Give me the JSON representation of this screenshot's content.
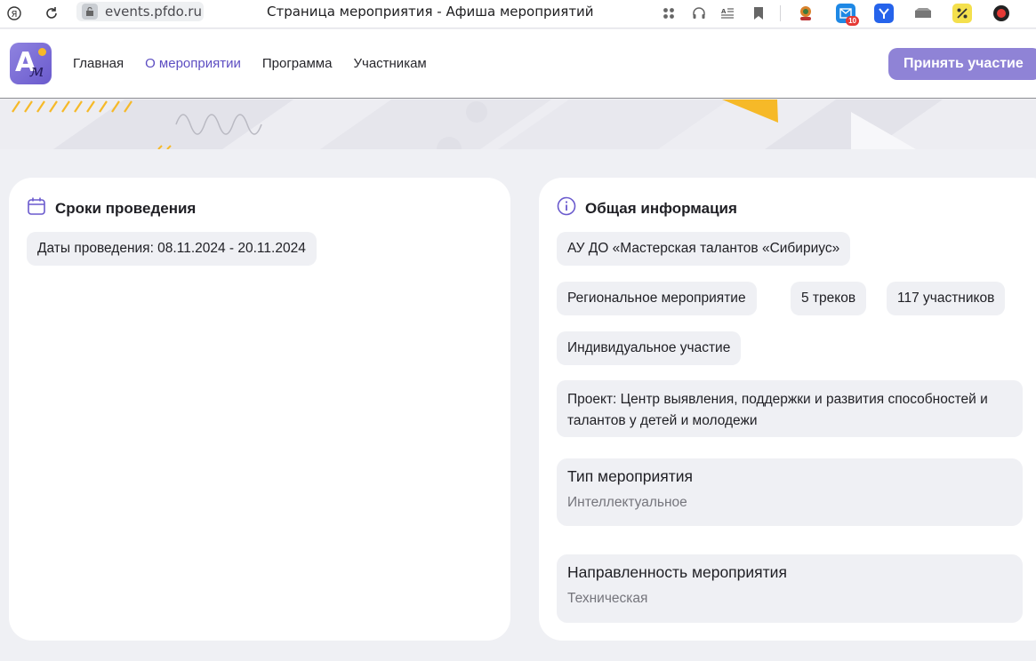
{
  "browser": {
    "url": "events.pfdo.ru",
    "tab_title": "Страница мероприятия - Афиша мероприятий",
    "mail_badge": "10"
  },
  "header": {
    "nav": [
      {
        "label": "Главная"
      },
      {
        "label": "О мероприятии",
        "active": true
      },
      {
        "label": "Программа"
      },
      {
        "label": "Участникам"
      }
    ],
    "cta_label": "Принять участие"
  },
  "schedule": {
    "title": "Сроки проведения",
    "dates": "Даты проведения: 08.11.2024 - 20.11.2024"
  },
  "general": {
    "title": "Общая информация",
    "organizer": "АУ ДО «Мастерская талантов «Сибириус»",
    "level": "Региональное мероприятие",
    "tracks": "5 треков",
    "participants": "117 участников",
    "participation": "Индивидуальное участие",
    "project": "Проект: Центр выявления, поддержки и развития способностей и талантов у детей и молодежи",
    "type_label": "Тип мероприятия",
    "type_value": "Интеллектуальное",
    "direction_label": "Направленность мероприятия",
    "direction_value": "Техническая"
  },
  "colors": {
    "accent": "#5d4ec2",
    "button": "#8f83d6",
    "background": "#eff0f4",
    "banner_yellow": "#f6b928"
  }
}
